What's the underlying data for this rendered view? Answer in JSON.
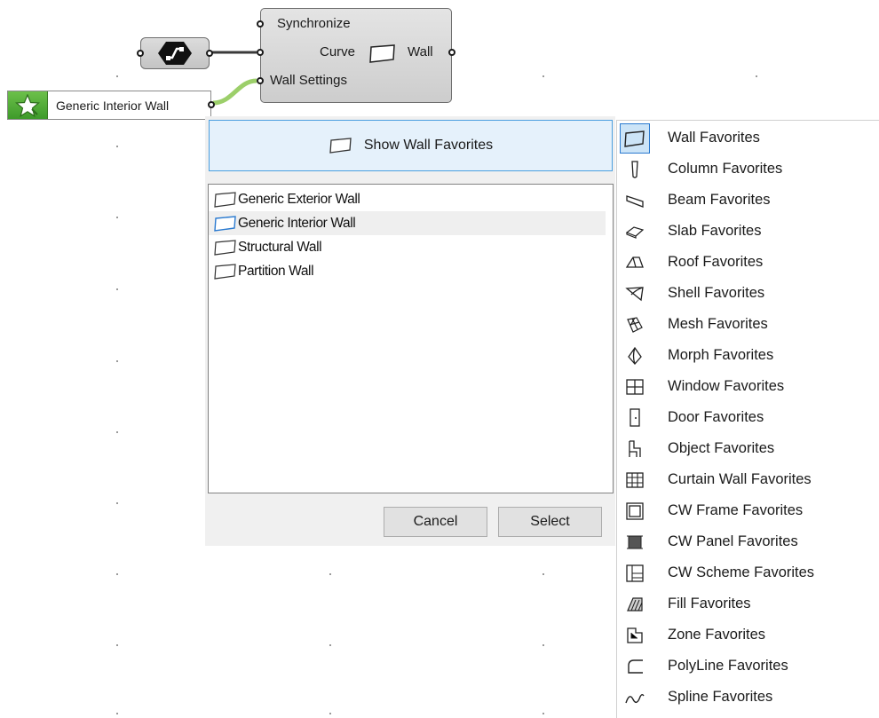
{
  "canvas": {
    "source_node": {
      "icon": "curve-path-icon"
    },
    "main_node": {
      "inputs": [
        "Synchronize",
        "Curve",
        "Wall Settings"
      ],
      "output": "Wall",
      "icon": "wall-icon"
    },
    "favorite_node": {
      "icon": "star-icon",
      "label": "Generic Interior Wall"
    }
  },
  "dialog": {
    "show_button": {
      "label": "Show Wall Favorites",
      "icon": "wall-icon"
    },
    "list": [
      {
        "label": "Generic Exterior Wall",
        "selected": false
      },
      {
        "label": "Generic Interior Wall",
        "selected": true
      },
      {
        "label": "Structural Wall",
        "selected": false
      },
      {
        "label": "Partition Wall",
        "selected": false
      }
    ],
    "cancel_label": "Cancel",
    "select_label": "Select"
  },
  "menu": {
    "items": [
      {
        "label": "Wall Favorites",
        "icon": "wall-icon",
        "active": true
      },
      {
        "label": "Column Favorites",
        "icon": "column-icon"
      },
      {
        "label": "Beam Favorites",
        "icon": "beam-icon"
      },
      {
        "label": "Slab Favorites",
        "icon": "slab-icon"
      },
      {
        "label": "Roof Favorites",
        "icon": "roof-icon"
      },
      {
        "label": "Shell Favorites",
        "icon": "shell-icon"
      },
      {
        "label": "Mesh Favorites",
        "icon": "mesh-icon"
      },
      {
        "label": "Morph Favorites",
        "icon": "morph-icon"
      },
      {
        "label": "Window Favorites",
        "icon": "window-icon"
      },
      {
        "label": "Door Favorites",
        "icon": "door-icon"
      },
      {
        "label": "Object Favorites",
        "icon": "object-icon"
      },
      {
        "label": "Curtain Wall Favorites",
        "icon": "curtain-wall-icon"
      },
      {
        "label": "CW Frame Favorites",
        "icon": "cw-frame-icon"
      },
      {
        "label": "CW Panel Favorites",
        "icon": "cw-panel-icon"
      },
      {
        "label": "CW Scheme Favorites",
        "icon": "cw-scheme-icon"
      },
      {
        "label": "Fill Favorites",
        "icon": "fill-icon"
      },
      {
        "label": "Zone Favorites",
        "icon": "zone-icon"
      },
      {
        "label": "PolyLine Favorites",
        "icon": "polyline-icon"
      },
      {
        "label": "Spline Favorites",
        "icon": "spline-icon"
      }
    ]
  },
  "colors": {
    "accent_blue": "#2a7ad0",
    "selection_bg": "#cce4f7",
    "button_hover_bg": "#e5f1fb",
    "favorite_green": "#4caf32",
    "wire_green": "#9ccf6a"
  }
}
